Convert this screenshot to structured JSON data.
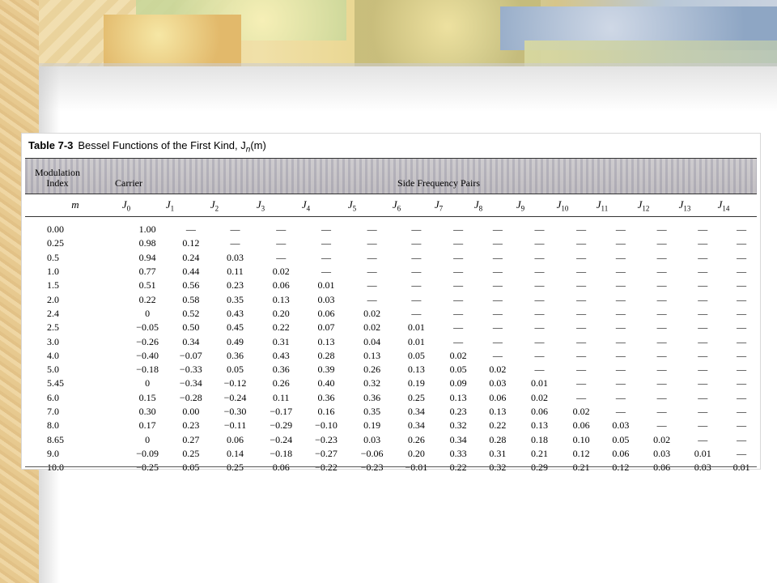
{
  "table": {
    "title_label": "Table 7-3",
    "title_text": "Bessel Functions of the First Kind, J",
    "title_sub": "n",
    "title_arg": "(m)",
    "header": {
      "modulation": "Modulation",
      "index": "Index",
      "carrier": "Carrier",
      "side_pairs": "Side Frequency Pairs"
    },
    "columns": [
      "m",
      "J0",
      "J1",
      "J2",
      "J3",
      "J4",
      "J5",
      "J6",
      "J7",
      "J8",
      "J9",
      "J10",
      "J11",
      "J12",
      "J13",
      "J14"
    ],
    "column_labels": [
      {
        "base": "m",
        "sub": ""
      },
      {
        "base": "J",
        "sub": "0"
      },
      {
        "base": "J",
        "sub": "1"
      },
      {
        "base": "J",
        "sub": "2"
      },
      {
        "base": "J",
        "sub": "3"
      },
      {
        "base": "J",
        "sub": "4"
      },
      {
        "base": "J",
        "sub": "5"
      },
      {
        "base": "J",
        "sub": "6"
      },
      {
        "base": "J",
        "sub": "7"
      },
      {
        "base": "J",
        "sub": "8"
      },
      {
        "base": "J",
        "sub": "9"
      },
      {
        "base": "J",
        "sub": "10"
      },
      {
        "base": "J",
        "sub": "11"
      },
      {
        "base": "J",
        "sub": "12"
      },
      {
        "base": "J",
        "sub": "13"
      },
      {
        "base": "J",
        "sub": "14"
      }
    ],
    "rows": [
      [
        "0.00",
        "1.00",
        "—",
        "—",
        "—",
        "—",
        "—",
        "—",
        "—",
        "—",
        "—",
        "—",
        "—",
        "—",
        "—",
        "—"
      ],
      [
        "0.25",
        "0.98",
        "0.12",
        "—",
        "—",
        "—",
        "—",
        "—",
        "—",
        "—",
        "—",
        "—",
        "—",
        "—",
        "—",
        "—"
      ],
      [
        "0.5",
        "0.94",
        "0.24",
        "0.03",
        "—",
        "—",
        "—",
        "—",
        "—",
        "—",
        "—",
        "—",
        "—",
        "—",
        "—",
        "—"
      ],
      [
        "1.0",
        "0.77",
        "0.44",
        "0.11",
        "0.02",
        "—",
        "—",
        "—",
        "—",
        "—",
        "—",
        "—",
        "—",
        "—",
        "—",
        "—"
      ],
      [
        "1.5",
        "0.51",
        "0.56",
        "0.23",
        "0.06",
        "0.01",
        "—",
        "—",
        "—",
        "—",
        "—",
        "—",
        "—",
        "—",
        "—",
        "—"
      ],
      [
        "2.0",
        "0.22",
        "0.58",
        "0.35",
        "0.13",
        "0.03",
        "—",
        "—",
        "—",
        "—",
        "—",
        "—",
        "—",
        "—",
        "—",
        "—"
      ],
      [
        "2.4",
        "0",
        "0.52",
        "0.43",
        "0.20",
        "0.06",
        "0.02",
        "—",
        "—",
        "—",
        "—",
        "—",
        "—",
        "—",
        "—",
        "—"
      ],
      [
        "2.5",
        "−0.05",
        "0.50",
        "0.45",
        "0.22",
        "0.07",
        "0.02",
        "0.01",
        "—",
        "—",
        "—",
        "—",
        "—",
        "—",
        "—",
        "—"
      ],
      [
        "3.0",
        "−0.26",
        "0.34",
        "0.49",
        "0.31",
        "0.13",
        "0.04",
        "0.01",
        "—",
        "—",
        "—",
        "—",
        "—",
        "—",
        "—",
        "—"
      ],
      [
        "4.0",
        "−0.40",
        "−0.07",
        "0.36",
        "0.43",
        "0.28",
        "0.13",
        "0.05",
        "0.02",
        "—",
        "—",
        "—",
        "—",
        "—",
        "—",
        "—"
      ],
      [
        "5.0",
        "−0.18",
        "−0.33",
        "0.05",
        "0.36",
        "0.39",
        "0.26",
        "0.13",
        "0.05",
        "0.02",
        "—",
        "—",
        "—",
        "—",
        "—",
        "—"
      ],
      [
        "5.45",
        "0",
        "−0.34",
        "−0.12",
        "0.26",
        "0.40",
        "0.32",
        "0.19",
        "0.09",
        "0.03",
        "0.01",
        "—",
        "—",
        "—",
        "—",
        "—"
      ],
      [
        "6.0",
        "0.15",
        "−0.28",
        "−0.24",
        "0.11",
        "0.36",
        "0.36",
        "0.25",
        "0.13",
        "0.06",
        "0.02",
        "—",
        "—",
        "—",
        "—",
        "—"
      ],
      [
        "7.0",
        "0.30",
        "0.00",
        "−0.30",
        "−0.17",
        "0.16",
        "0.35",
        "0.34",
        "0.23",
        "0.13",
        "0.06",
        "0.02",
        "—",
        "—",
        "—",
        "—"
      ],
      [
        "8.0",
        "0.17",
        "0.23",
        "−0.11",
        "−0.29",
        "−0.10",
        "0.19",
        "0.34",
        "0.32",
        "0.22",
        "0.13",
        "0.06",
        "0.03",
        "—",
        "—",
        "—"
      ],
      [
        "8.65",
        "0",
        "0.27",
        "0.06",
        "−0.24",
        "−0.23",
        "0.03",
        "0.26",
        "0.34",
        "0.28",
        "0.18",
        "0.10",
        "0.05",
        "0.02",
        "—",
        "—"
      ],
      [
        "9.0",
        "−0.09",
        "0.25",
        "0.14",
        "−0.18",
        "−0.27",
        "−0.06",
        "0.20",
        "0.33",
        "0.31",
        "0.21",
        "0.12",
        "0.06",
        "0.03",
        "0.01",
        "—"
      ],
      [
        "10.0",
        "−0.25",
        "0.05",
        "0.25",
        "0.06",
        "−0.22",
        "−0.23",
        "−0.01",
        "0.22",
        "0.32",
        "0.29",
        "0.21",
        "0.12",
        "0.06",
        "0.03",
        "0.01"
      ]
    ]
  }
}
